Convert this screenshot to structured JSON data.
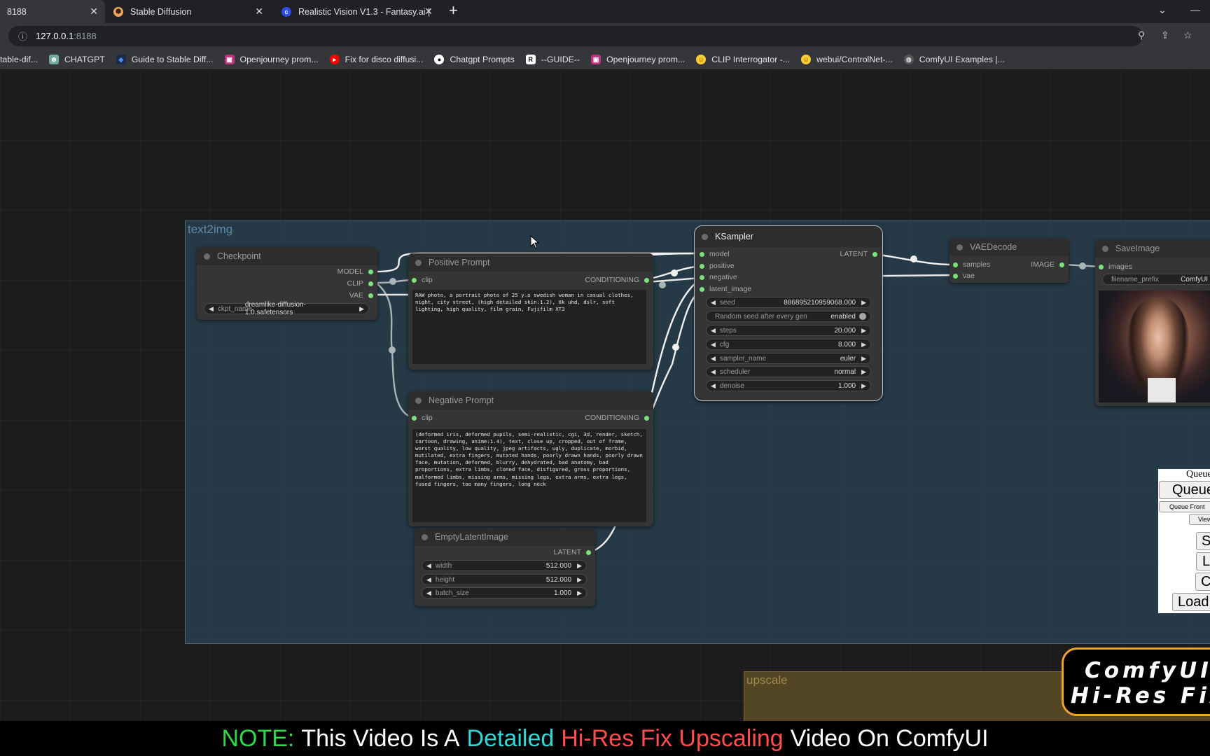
{
  "browser": {
    "tabs": [
      {
        "title": "8188",
        "active": true,
        "icon": "comfyui-icon"
      },
      {
        "title": "Stable Diffusion",
        "active": false,
        "icon": "stable-diffusion-icon"
      },
      {
        "title": "Realistic Vision V1.3 - Fantasy.ai |",
        "active": false,
        "icon": "civitai-icon"
      }
    ],
    "close_glyph": "✕",
    "new_tab_glyph": "+",
    "address": {
      "host": "127.0.0.1",
      "port": ":8188"
    },
    "bookmarks": [
      {
        "label": "table-dif...",
        "icon": "none",
        "color": ""
      },
      {
        "label": "CHATGPT",
        "icon": "openai-icon",
        "color": "#74aa9c"
      },
      {
        "label": "Guide to Stable Diff...",
        "icon": "diamond-icon",
        "color": "#2c6ed5"
      },
      {
        "label": "Openjourney prom...",
        "icon": "openjourney-icon",
        "color": "#c0337a"
      },
      {
        "label": "Fix for disco diffusi...",
        "icon": "youtube-icon",
        "color": "#ff0000"
      },
      {
        "label": "Chatgpt Prompts",
        "icon": "github-icon",
        "color": "#ffffff"
      },
      {
        "label": "--GUIDE--",
        "icon": "r-icon",
        "color": "#ffffff"
      },
      {
        "label": "Openjourney prom...",
        "icon": "openjourney-icon",
        "color": "#c0337a"
      },
      {
        "label": "CLIP Interrogator -...",
        "icon": "huggingface-icon",
        "color": "#ffcc33"
      },
      {
        "label": "webui/ControlNet-...",
        "icon": "huggingface-icon",
        "color": "#ffcc33"
      },
      {
        "label": "ComfyUI Examples |...",
        "icon": "globe-icon",
        "color": "#aaaaaa"
      }
    ]
  },
  "groups": {
    "text2img": {
      "title": "text2img",
      "color": "#335d7a",
      "title_color": "#5e8aaa"
    },
    "upscale": {
      "title": "upscale",
      "color": "#5a4c25",
      "title_color": "#a08a50"
    }
  },
  "nodes": {
    "checkpoint": {
      "title": "Checkpoint",
      "outputs": [
        "MODEL",
        "CLIP",
        "VAE"
      ],
      "widget": {
        "label": "ckpt_name",
        "value": "dreamlike-diffusion-1.0.safetensors"
      }
    },
    "positive_prompt": {
      "title": "Positive Prompt",
      "input": "clip",
      "output": "CONDITIONING",
      "text": "RAW photo, a portrait photo of 25 y.o swedish woman in casual clothes, night, city street, (high detailed skin:1.2), 8k uhd, dslr, soft lighting, high quality, film grain, Fujifilm XT3"
    },
    "negative_prompt": {
      "title": "Negative Prompt",
      "input": "clip",
      "output": "CONDITIONING",
      "text": "(deformed iris, deformed pupils, semi-realistic, cgi, 3d, render, sketch, cartoon, drawing, anime:1.4), text, close up, cropped, out of frame, worst quality, low quality, jpeg artifacts, ugly, duplicate, morbid, mutilated, extra fingers, mutated hands, poorly drawn hands, poorly drawn face, mutation, deformed, blurry, dehydrated, bad anatomy, bad proportions, extra limbs, cloned face, disfigured, gross proportions, malformed limbs, missing arms, missing legs, extra arms, extra legs, fused fingers, too many fingers, long neck"
    },
    "empty_latent": {
      "title": "EmptyLatentImage",
      "output": "LATENT",
      "widgets": [
        {
          "label": "width",
          "value": "512.000"
        },
        {
          "label": "height",
          "value": "512.000"
        },
        {
          "label": "batch_size",
          "value": "1.000"
        }
      ]
    },
    "ksampler": {
      "title": "KSampler",
      "inputs": [
        "model",
        "positive",
        "negative",
        "latent_image"
      ],
      "output": "LATENT",
      "widgets": [
        {
          "label": "seed",
          "value": "886895210959068.000"
        },
        {
          "label": "Random seed after every gen",
          "value": "enabled",
          "toggle": true
        },
        {
          "label": "steps",
          "value": "20.000"
        },
        {
          "label": "cfg",
          "value": "8.000"
        },
        {
          "label": "sampler_name",
          "value": "euler"
        },
        {
          "label": "scheduler",
          "value": "normal"
        },
        {
          "label": "denoise",
          "value": "1.000"
        }
      ]
    },
    "vae_decode": {
      "title": "VAEDecode",
      "inputs": [
        "samples",
        "vae"
      ],
      "output": "IMAGE"
    },
    "save_image": {
      "title": "SaveImage",
      "input": "images",
      "widget": {
        "label": "filename_prefix",
        "value": "ComfyUI"
      }
    }
  },
  "queue_panel": {
    "header": "Queue",
    "queue_prompt": "Queue",
    "queue_front": "Queue Front",
    "view": "View",
    "save": "S",
    "load": "L",
    "clear": "C",
    "load_default": "Load"
  },
  "overlay": {
    "card_line1": "ComfyUI",
    "card_line2": "Hi-Res Fix",
    "note": [
      {
        "text": "NOTE:",
        "color": "#2fd84a"
      },
      {
        "text": "This Video Is A",
        "color": "#ffffff"
      },
      {
        "text": "Detailed",
        "color": "#33d6d6"
      },
      {
        "text": "Hi-Res Fix Upscaling",
        "color": "#ff4d4d"
      },
      {
        "text": "Video On ComfyUI",
        "color": "#ffffff"
      }
    ]
  }
}
